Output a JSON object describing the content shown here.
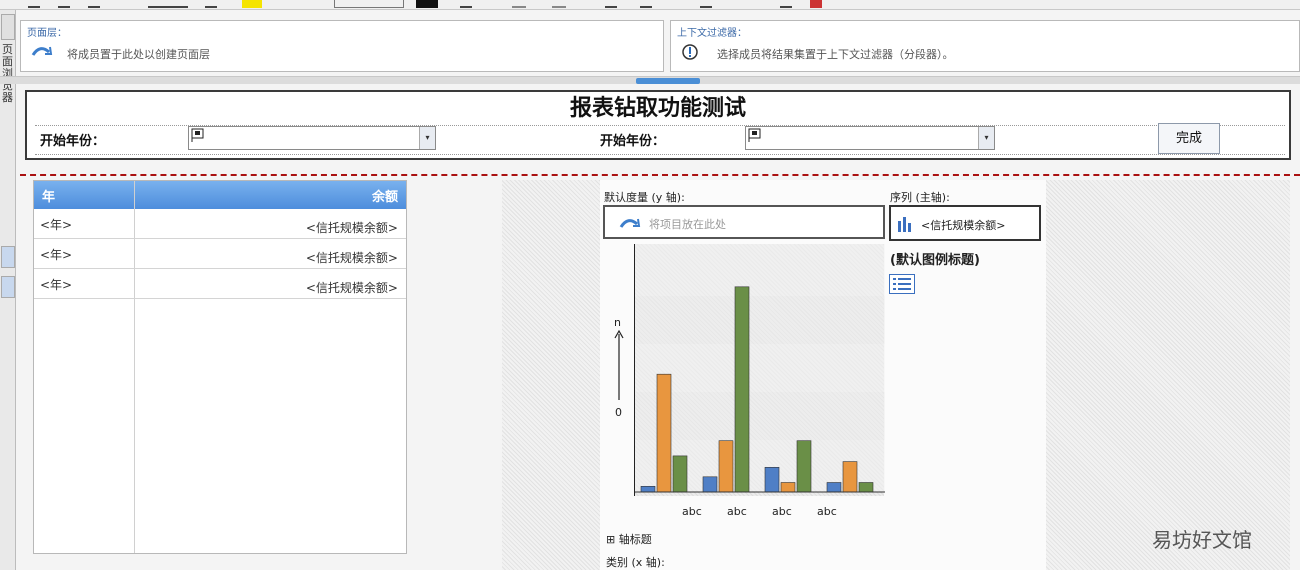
{
  "prompt_page": {
    "title": "报表钻取功能测试",
    "start_year_label_1": "开始年份：",
    "start_year_label_2": "开始年份：",
    "finish_button": "完成"
  },
  "list": {
    "col_year": "年",
    "col_balance": "余额",
    "rows": [
      {
        "year": "<年>",
        "balance": "<信托规模余额>"
      },
      {
        "year": "<年>",
        "balance": "<信托规模余额>"
      },
      {
        "year": "<年>",
        "balance": "<信托规模余额>"
      }
    ]
  },
  "chart": {
    "y_axis_caption": "默认度量 (y 轴):",
    "y_drop_hint": "将项目放在此处",
    "series_caption": "序列 (主轴):",
    "series_item": "<信托规模余额>",
    "legend_title": "(默认图例标题)",
    "axis_title_caption": "轴标题",
    "x_axis_caption": "类别 (x 轴):",
    "watermark": "易坊好文馆"
  },
  "chart_data": {
    "type": "bar",
    "categories": [
      "abc",
      "abc",
      "abc",
      "abc"
    ],
    "y_ticks": [
      "n",
      "0"
    ],
    "series": [
      {
        "color": "#4f7fc6",
        "values": [
          0.03,
          0.08,
          0.13,
          0.05
        ]
      },
      {
        "color": "#e8963f",
        "values": [
          0.62,
          0.27,
          0.05,
          0.16
        ]
      },
      {
        "color": "#6a8f47",
        "values": [
          0.19,
          1.08,
          0.27,
          0.05
        ]
      }
    ]
  }
}
